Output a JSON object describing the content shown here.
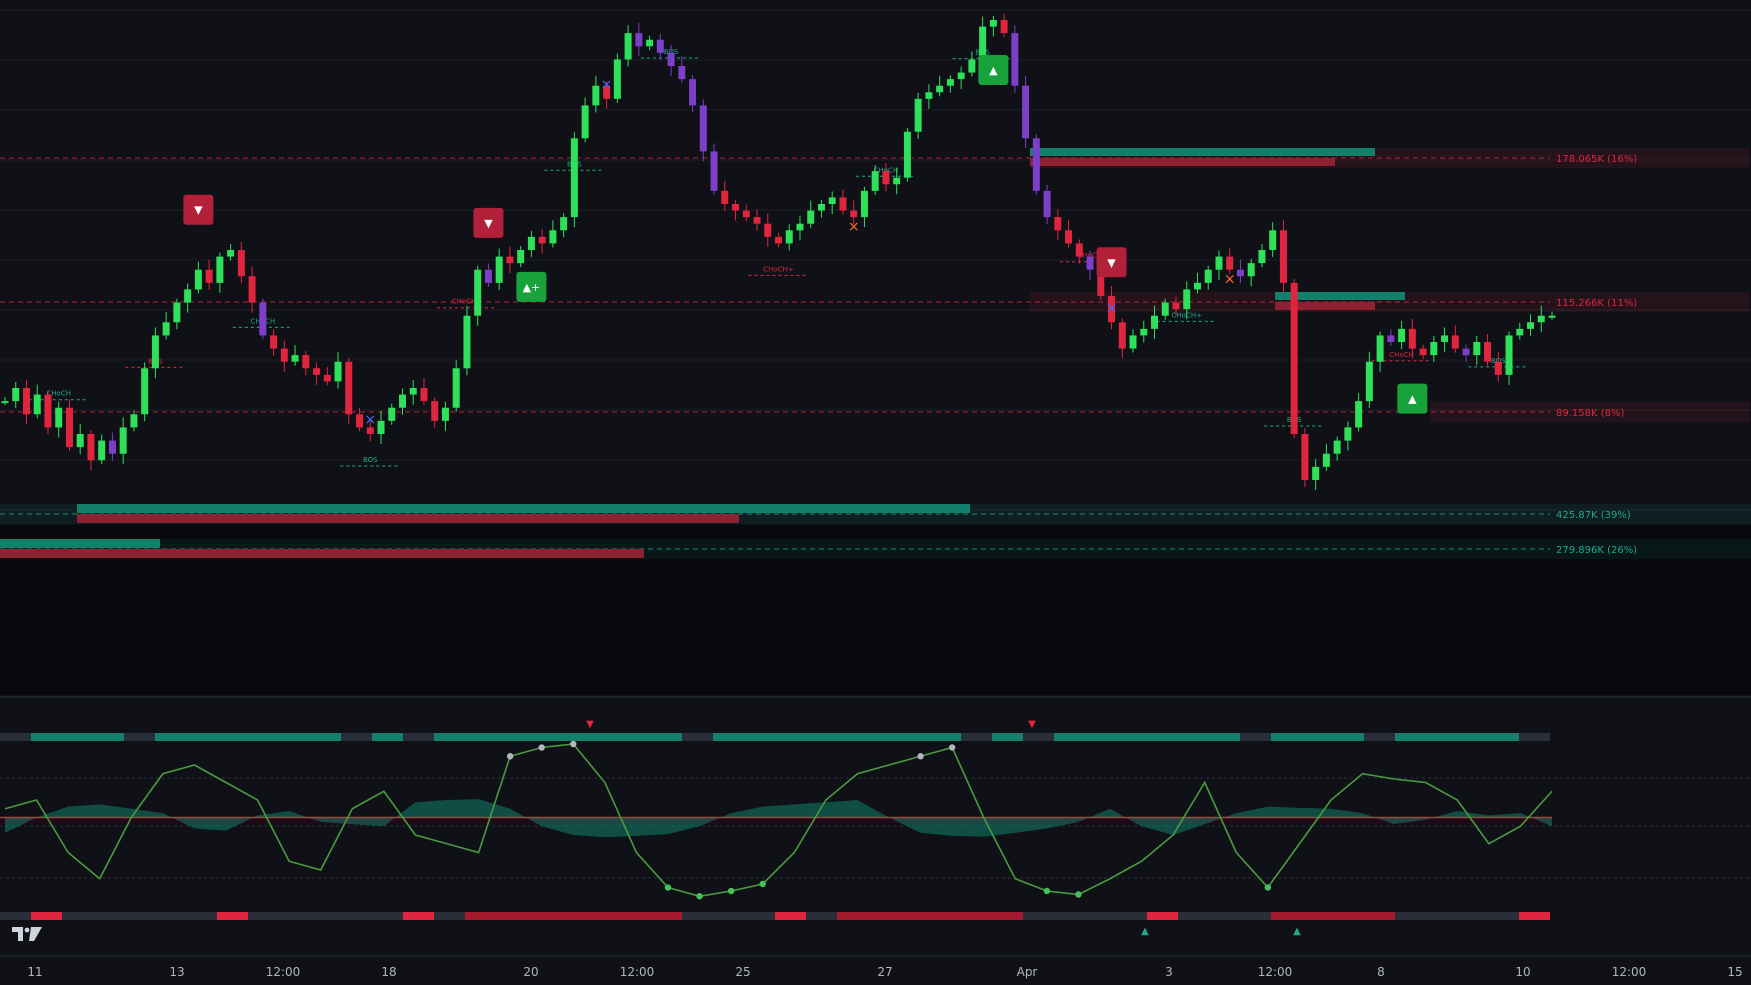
{
  "colors": {
    "background": "#0f1117",
    "bull": "#2ee05a",
    "bear": "#e0263e",
    "neutral": "#7b3fc8",
    "teal": "#12806b",
    "maroon": "#8c2232",
    "grid": "#1c1f28"
  },
  "icons": {
    "sell_marker": "triangle-down-badge",
    "buy_marker": "triangle-up-badge",
    "swing_marker": "x-mark",
    "logo": "tradingview-logo"
  },
  "chart_data": [
    {
      "type": "line",
      "panel": "price",
      "grid": true,
      "x_tick_labels": [
        "11",
        "13",
        "12:00",
        "18",
        "20",
        "12:00",
        "25",
        "27",
        "Apr",
        "3",
        "12:00",
        "8",
        "10",
        "12:00",
        "15"
      ],
      "levels": [
        {
          "label": "178.065K (16%)",
          "color": "#e0263e"
        },
        {
          "label": "115.266K (11%)",
          "color": "#e0263e"
        },
        {
          "label": "89.158K (8%)",
          "color": "#e0263e"
        },
        {
          "label": "425.87K (39%)",
          "color": "#1fa98a"
        },
        {
          "label": "279.896K (26%)",
          "color": "#1fa98a"
        }
      ],
      "structure_labels": [
        "CHoCH",
        "BOS",
        "CHoCH",
        "BOS",
        "CHoCH+",
        "BOS",
        "BOS",
        "CHoCH+",
        "CHoCH",
        "BOS",
        "CHoCH",
        "CHoCH+",
        "BOS",
        "CHoCH",
        "BOS"
      ],
      "signals": [
        {
          "type": "sell",
          "label": "▼"
        },
        {
          "type": "buy",
          "label": "▲+"
        },
        {
          "type": "sell",
          "label": "▼"
        },
        {
          "type": "buy",
          "label": "▲"
        },
        {
          "type": "sell",
          "label": "▼"
        },
        {
          "type": "buy",
          "label": "▲"
        }
      ],
      "series": [
        {
          "values": [
            40,
            42,
            38,
            41,
            36,
            39,
            33,
            35,
            31,
            34,
            32,
            36,
            38,
            45,
            50,
            52,
            55,
            57,
            60,
            58,
            62,
            63,
            59,
            55,
            50,
            48,
            46,
            47,
            45,
            44,
            43,
            46,
            38,
            36,
            35,
            37,
            39,
            41,
            42,
            40,
            37,
            39,
            45,
            53,
            60,
            58,
            62,
            61,
            63,
            65,
            64,
            66,
            68,
            80,
            85,
            88,
            86,
            92,
            96,
            94,
            95,
            93,
            91,
            89,
            85,
            78,
            72,
            70,
            69,
            68,
            67,
            65,
            64,
            66,
            67,
            69,
            70,
            71,
            69,
            68,
            72,
            75,
            73,
            74,
            81,
            86,
            87,
            88,
            89,
            90,
            92,
            97,
            98,
            96,
            88,
            80,
            72,
            68,
            66,
            64,
            62,
            60,
            56,
            52,
            48,
            50,
            51,
            53,
            55,
            54,
            57,
            58,
            60,
            62,
            60,
            59,
            61,
            63,
            66,
            58,
            35,
            28,
            30,
            32,
            34,
            36,
            40,
            46,
            50,
            49,
            51,
            48,
            47,
            49,
            50,
            48,
            47,
            49,
            46,
            44,
            50,
            51,
            52,
            53,
            53
          ]
        }
      ]
    },
    {
      "type": "line",
      "panel": "oscillator",
      "grid": true,
      "series": [
        {
          "values": [
            0.55,
            0.6,
            0.3,
            0.15,
            0.5,
            0.75,
            0.8,
            0.7,
            0.6,
            0.25,
            0.2,
            0.55,
            0.65,
            0.4,
            0.35,
            0.3,
            0.85,
            0.9,
            0.92,
            0.7,
            0.3,
            0.1,
            0.05,
            0.08,
            0.12,
            0.3,
            0.6,
            0.75,
            0.8,
            0.85,
            0.9,
            0.5,
            0.15,
            0.08,
            0.06,
            0.15,
            0.25,
            0.4,
            0.7,
            0.3,
            0.1,
            0.35,
            0.6,
            0.75,
            0.72,
            0.7,
            0.6,
            0.35,
            0.45,
            0.65
          ]
        }
      ]
    }
  ]
}
